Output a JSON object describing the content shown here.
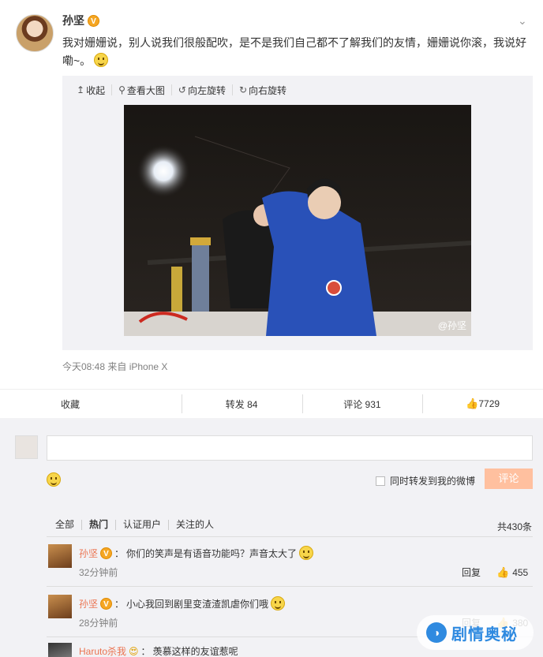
{
  "post": {
    "author": "孙坚",
    "verified_badge": "V",
    "text": "我对姗姗说，别人说我们很般配吹，是不是我们自己都不了解我们的友情，姗姗说你滚，我说好嘞~。",
    "time_source": "今天08:48 来自 iPhone X",
    "media_toolbar": [
      "收起",
      "查看大图",
      "向左旋转",
      "向右旋转"
    ],
    "watermark": "@孙坚",
    "colors": {
      "accent": "#eb7350",
      "verified": "#f5a623",
      "submit_bg": "#ffc09f"
    }
  },
  "actions": {
    "favorite": "收藏",
    "repost": "转发 84",
    "comment": "评论 931",
    "like": "7729"
  },
  "composer": {
    "forward_label": "同时转发到我的微博",
    "submit_label": "评论"
  },
  "filters": {
    "tabs": [
      "全部",
      "热门",
      "认证用户",
      "关注的人"
    ],
    "total": "共430条"
  },
  "comments": [
    {
      "user": "孙坚",
      "badge": "V",
      "text": "你们的笑声是有语音功能吗？声音太大了",
      "time": "32分钟前",
      "reply": "回复",
      "likes": "455"
    },
    {
      "user": "孙坚",
      "badge": "V",
      "text": "小心我回到剧里变渣渣凯虐你们哦",
      "time": "28分钟前",
      "reply": "回复",
      "likes": "380"
    },
    {
      "user": "Haruto杀我",
      "text": "羡慕这样的友谊惹呢"
    }
  ],
  "brand_watermark": "剧情奥秘"
}
